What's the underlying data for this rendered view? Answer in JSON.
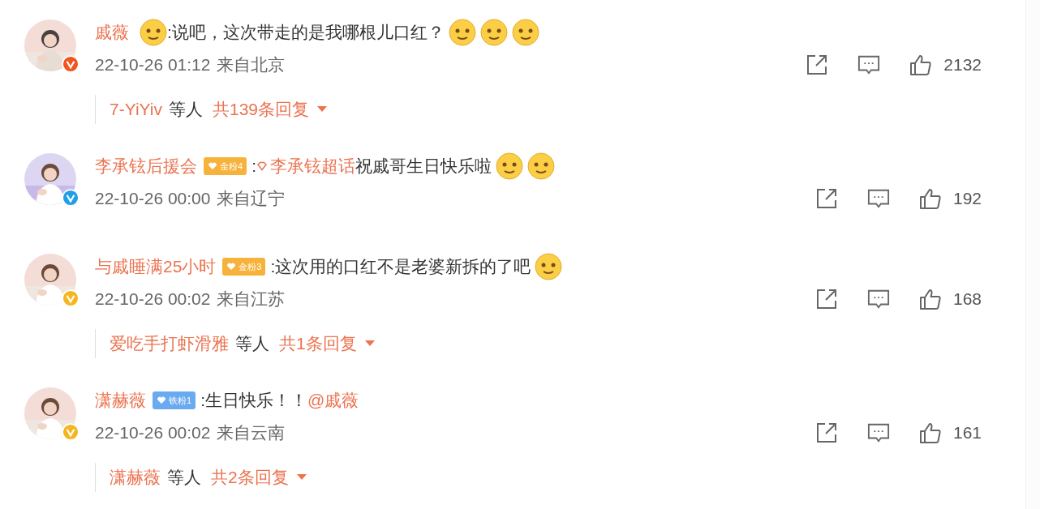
{
  "comments": [
    {
      "name": "戚薇",
      "verified": {
        "color": "#f0561d"
      },
      "content": [
        {
          "kind": "emoji"
        },
        {
          "kind": "text",
          "text": ":说吧，这次带走的是我哪根儿口红？"
        },
        {
          "kind": "emoji"
        },
        {
          "kind": "emoji"
        },
        {
          "kind": "emoji"
        }
      ],
      "time": "22-10-26 01:12",
      "source": "来自北京",
      "likes": "2132",
      "replies": {
        "names": "7-YiYiv",
        "others": "等人",
        "total": "共139条回复"
      }
    },
    {
      "name": "李承铉后援会",
      "verified": {
        "color": "#1e9fe8"
      },
      "badge": {
        "label": "金粉4",
        "color": "#f7b23b"
      },
      "content": [
        {
          "kind": "text",
          "text": ":"
        },
        {
          "kind": "topic",
          "text": "李承铉超话"
        },
        {
          "kind": "text",
          "text": "祝戚哥生日快乐啦"
        },
        {
          "kind": "emoji"
        },
        {
          "kind": "emoji"
        }
      ],
      "time": "22-10-26 00:00",
      "source": "来自辽宁",
      "likes": "192"
    },
    {
      "name": "与戚睡满25小时",
      "verified": {
        "color": "#f5b51e"
      },
      "badge": {
        "label": "金粉3",
        "color": "#f7b23b"
      },
      "content": [
        {
          "kind": "text",
          "text": ":这次用的口红不是老婆新拆的了吧"
        },
        {
          "kind": "emoji"
        }
      ],
      "time": "22-10-26 00:02",
      "source": "来自江苏",
      "likes": "168",
      "replies": {
        "names": "爱吃手打虾滑雅",
        "others": "等人",
        "total": "共1条回复"
      }
    },
    {
      "name": "潇赫薇",
      "verified": {
        "color": "#f5b51e"
      },
      "badge": {
        "label": "铁粉1",
        "color": "#6aaaf0"
      },
      "content": [
        {
          "kind": "text",
          "text": ":生日快乐！！"
        },
        {
          "kind": "mention",
          "text": "@戚薇"
        }
      ],
      "time": "22-10-26 00:02",
      "source": "来自云南",
      "likes": "161",
      "replies": {
        "names": "潇赫薇",
        "others": "等人",
        "total": "共2条回复"
      }
    }
  ]
}
